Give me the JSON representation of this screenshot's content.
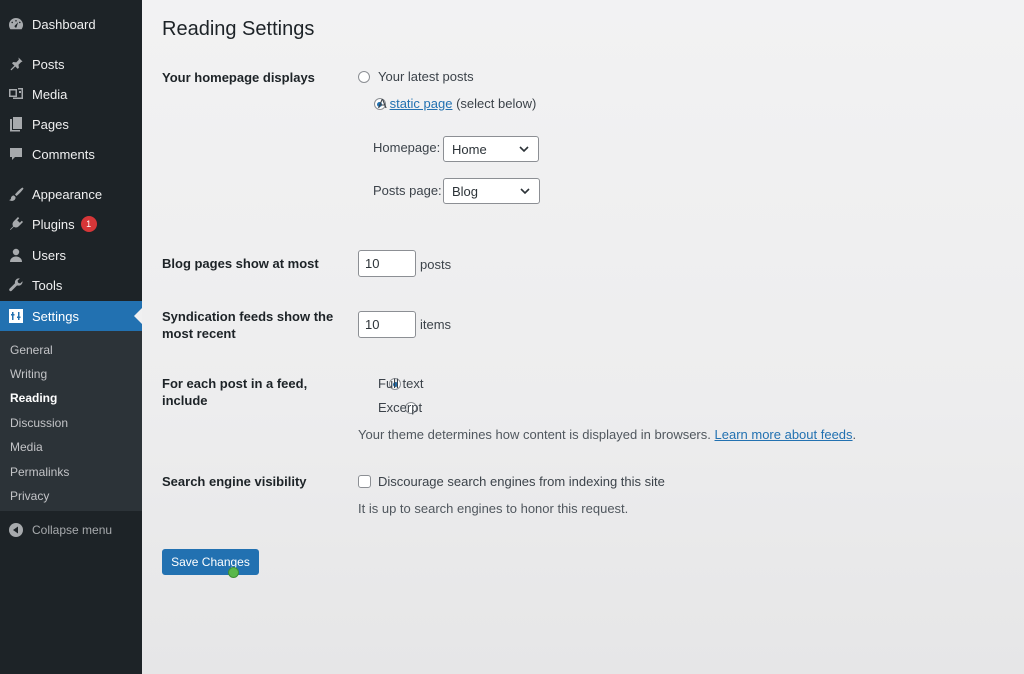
{
  "sidebar": {
    "items": [
      {
        "label": "Dashboard",
        "icon": "dashboard-icon"
      },
      {
        "label": "Posts",
        "icon": "pin-icon"
      },
      {
        "label": "Media",
        "icon": "media-icon"
      },
      {
        "label": "Pages",
        "icon": "pages-icon"
      },
      {
        "label": "Comments",
        "icon": "comment-icon"
      },
      {
        "label": "Appearance",
        "icon": "brush-icon"
      },
      {
        "label": "Plugins",
        "icon": "plug-icon",
        "badge": "1"
      },
      {
        "label": "Users",
        "icon": "user-icon"
      },
      {
        "label": "Tools",
        "icon": "wrench-icon"
      },
      {
        "label": "Settings",
        "icon": "settings-icon",
        "active": true
      }
    ],
    "submenu": [
      "General",
      "Writing",
      "Reading",
      "Discussion",
      "Media",
      "Permalinks",
      "Privacy"
    ],
    "current_submenu": "Reading",
    "collapse_label": "Collapse menu"
  },
  "page": {
    "title": "Reading Settings",
    "homepage_displays": {
      "label": "Your homepage displays",
      "option_latest": "Your latest posts",
      "option_static_prefix": "A",
      "option_static_link": "static page",
      "option_static_suffix": "(select below)",
      "selected": "static",
      "homepage_label": "Homepage:",
      "homepage_value": "Home",
      "posts_page_label": "Posts page:",
      "posts_page_value": "Blog"
    },
    "blog_pages": {
      "label": "Blog pages show at most",
      "value": "10",
      "unit": "posts"
    },
    "syndication": {
      "label": "Syndication feeds show the most recent",
      "value": "10",
      "unit": "items"
    },
    "feed_include": {
      "label": "For each post in a feed, include",
      "option_full": "Full text",
      "option_excerpt": "Excerpt",
      "selected": "full",
      "description": "Your theme determines how content is displayed in browsers.",
      "link": "Learn more about feeds",
      "link_suffix": "."
    },
    "search_visibility": {
      "label": "Search engine visibility",
      "checkbox_label": "Discourage search engines from indexing this site",
      "checked": false,
      "description": "It is up to search engines to honor this request."
    },
    "save_label": "Save Changes"
  },
  "colors": {
    "sidebar_bg": "#1d2327",
    "submenu_bg": "#2c3338",
    "accent": "#2271b1",
    "badge": "#d63638"
  }
}
